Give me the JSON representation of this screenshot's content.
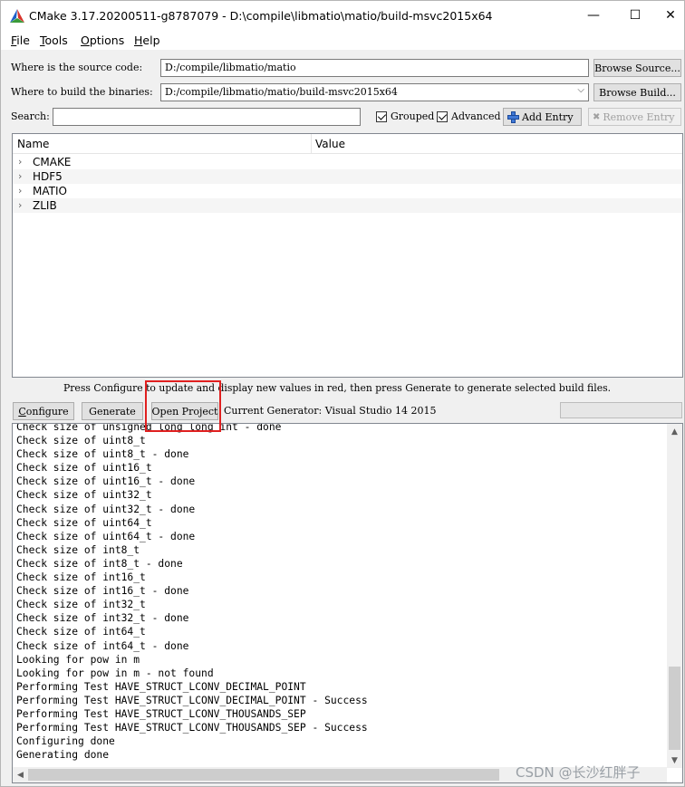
{
  "window": {
    "title": "CMake 3.17.20200511-g8787079 - D:\\compile\\libmatio\\matio/build-msvc2015x64",
    "minimize_glyph": "—",
    "maximize_glyph": "☐",
    "close_glyph": "✕"
  },
  "menu": {
    "file": {
      "u": "F",
      "rest": "ile"
    },
    "tools": {
      "u": "T",
      "rest": "ools"
    },
    "options": {
      "u": "O",
      "rest": "ptions"
    },
    "help": {
      "u": "H",
      "rest": "elp"
    }
  },
  "source": {
    "label": "Where is the source code:",
    "value": "D:/compile/libmatio/matio",
    "browse_label": "Browse Source..."
  },
  "build": {
    "label": "Where to build the binaries:",
    "value": "D:/compile/libmatio/matio/build-msvc2015x64",
    "browse_label": "Browse Build..."
  },
  "search": {
    "label": "Search:",
    "value": "",
    "grouped_label": "Grouped",
    "grouped_checked": true,
    "advanced_label": "Advanced",
    "advanced_checked": true,
    "add_entry_label": "Add Entry",
    "remove_entry_label": "Remove Entry"
  },
  "tree": {
    "col_name": "Name",
    "col_value": "Value",
    "groups": [
      "CMAKE",
      "HDF5",
      "MATIO",
      "ZLIB"
    ]
  },
  "hint": "Press Configure to update and display new values in red, then press Generate to generate selected build files.",
  "actions": {
    "configure_label": "Configure",
    "generate_label": "Generate",
    "open_project_label": "Open Project",
    "current_generator": "Current Generator: Visual Studio 14 2015"
  },
  "log": [
    "Check size of unsigned long long int - done",
    "Check size of uint8_t",
    "Check size of uint8_t - done",
    "Check size of uint16_t",
    "Check size of uint16_t - done",
    "Check size of uint32_t",
    "Check size of uint32_t - done",
    "Check size of uint64_t",
    "Check size of uint64_t - done",
    "Check size of int8_t",
    "Check size of int8_t - done",
    "Check size of int16_t",
    "Check size of int16_t - done",
    "Check size of int32_t",
    "Check size of int32_t - done",
    "Check size of int64_t",
    "Check size of int64_t - done",
    "Looking for pow in m",
    "Looking for pow in m - not found",
    "Performing Test HAVE_STRUCT_LCONV_DECIMAL_POINT",
    "Performing Test HAVE_STRUCT_LCONV_DECIMAL_POINT - Success",
    "Performing Test HAVE_STRUCT_LCONV_THOUSANDS_SEP",
    "Performing Test HAVE_STRUCT_LCONV_THOUSANDS_SEP - Success",
    "Configuring done",
    "Generating done"
  ],
  "watermark": "CSDN @长沙红胖子",
  "colors": {
    "highlight": "#e02020",
    "cmake_blue": "#1f5fc8",
    "cmake_red": "#d8332b",
    "cmake_green": "#3a9a3a"
  }
}
